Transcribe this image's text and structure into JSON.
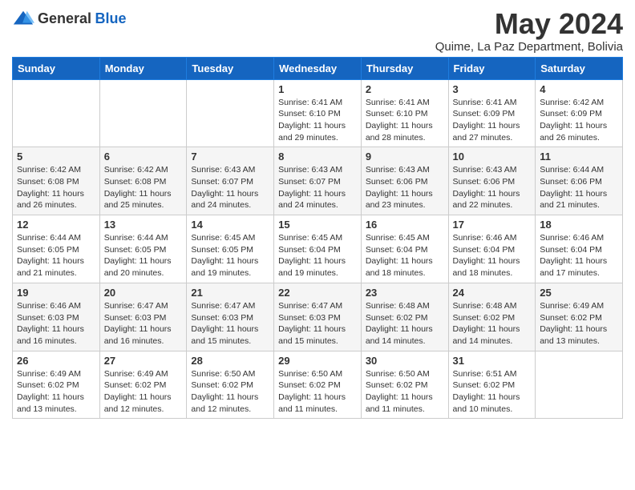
{
  "logo": {
    "general": "General",
    "blue": "Blue"
  },
  "header": {
    "month": "May 2024",
    "location": "Quime, La Paz Department, Bolivia"
  },
  "weekdays": [
    "Sunday",
    "Monday",
    "Tuesday",
    "Wednesday",
    "Thursday",
    "Friday",
    "Saturday"
  ],
  "weeks": [
    [
      {
        "day": "",
        "info": ""
      },
      {
        "day": "",
        "info": ""
      },
      {
        "day": "",
        "info": ""
      },
      {
        "day": "1",
        "info": "Sunrise: 6:41 AM\nSunset: 6:10 PM\nDaylight: 11 hours and 29 minutes."
      },
      {
        "day": "2",
        "info": "Sunrise: 6:41 AM\nSunset: 6:10 PM\nDaylight: 11 hours and 28 minutes."
      },
      {
        "day": "3",
        "info": "Sunrise: 6:41 AM\nSunset: 6:09 PM\nDaylight: 11 hours and 27 minutes."
      },
      {
        "day": "4",
        "info": "Sunrise: 6:42 AM\nSunset: 6:09 PM\nDaylight: 11 hours and 26 minutes."
      }
    ],
    [
      {
        "day": "5",
        "info": "Sunrise: 6:42 AM\nSunset: 6:08 PM\nDaylight: 11 hours and 26 minutes."
      },
      {
        "day": "6",
        "info": "Sunrise: 6:42 AM\nSunset: 6:08 PM\nDaylight: 11 hours and 25 minutes."
      },
      {
        "day": "7",
        "info": "Sunrise: 6:43 AM\nSunset: 6:07 PM\nDaylight: 11 hours and 24 minutes."
      },
      {
        "day": "8",
        "info": "Sunrise: 6:43 AM\nSunset: 6:07 PM\nDaylight: 11 hours and 24 minutes."
      },
      {
        "day": "9",
        "info": "Sunrise: 6:43 AM\nSunset: 6:06 PM\nDaylight: 11 hours and 23 minutes."
      },
      {
        "day": "10",
        "info": "Sunrise: 6:43 AM\nSunset: 6:06 PM\nDaylight: 11 hours and 22 minutes."
      },
      {
        "day": "11",
        "info": "Sunrise: 6:44 AM\nSunset: 6:06 PM\nDaylight: 11 hours and 21 minutes."
      }
    ],
    [
      {
        "day": "12",
        "info": "Sunrise: 6:44 AM\nSunset: 6:05 PM\nDaylight: 11 hours and 21 minutes."
      },
      {
        "day": "13",
        "info": "Sunrise: 6:44 AM\nSunset: 6:05 PM\nDaylight: 11 hours and 20 minutes."
      },
      {
        "day": "14",
        "info": "Sunrise: 6:45 AM\nSunset: 6:05 PM\nDaylight: 11 hours and 19 minutes."
      },
      {
        "day": "15",
        "info": "Sunrise: 6:45 AM\nSunset: 6:04 PM\nDaylight: 11 hours and 19 minutes."
      },
      {
        "day": "16",
        "info": "Sunrise: 6:45 AM\nSunset: 6:04 PM\nDaylight: 11 hours and 18 minutes."
      },
      {
        "day": "17",
        "info": "Sunrise: 6:46 AM\nSunset: 6:04 PM\nDaylight: 11 hours and 18 minutes."
      },
      {
        "day": "18",
        "info": "Sunrise: 6:46 AM\nSunset: 6:04 PM\nDaylight: 11 hours and 17 minutes."
      }
    ],
    [
      {
        "day": "19",
        "info": "Sunrise: 6:46 AM\nSunset: 6:03 PM\nDaylight: 11 hours and 16 minutes."
      },
      {
        "day": "20",
        "info": "Sunrise: 6:47 AM\nSunset: 6:03 PM\nDaylight: 11 hours and 16 minutes."
      },
      {
        "day": "21",
        "info": "Sunrise: 6:47 AM\nSunset: 6:03 PM\nDaylight: 11 hours and 15 minutes."
      },
      {
        "day": "22",
        "info": "Sunrise: 6:47 AM\nSunset: 6:03 PM\nDaylight: 11 hours and 15 minutes."
      },
      {
        "day": "23",
        "info": "Sunrise: 6:48 AM\nSunset: 6:02 PM\nDaylight: 11 hours and 14 minutes."
      },
      {
        "day": "24",
        "info": "Sunrise: 6:48 AM\nSunset: 6:02 PM\nDaylight: 11 hours and 14 minutes."
      },
      {
        "day": "25",
        "info": "Sunrise: 6:49 AM\nSunset: 6:02 PM\nDaylight: 11 hours and 13 minutes."
      }
    ],
    [
      {
        "day": "26",
        "info": "Sunrise: 6:49 AM\nSunset: 6:02 PM\nDaylight: 11 hours and 13 minutes."
      },
      {
        "day": "27",
        "info": "Sunrise: 6:49 AM\nSunset: 6:02 PM\nDaylight: 11 hours and 12 minutes."
      },
      {
        "day": "28",
        "info": "Sunrise: 6:50 AM\nSunset: 6:02 PM\nDaylight: 11 hours and 12 minutes."
      },
      {
        "day": "29",
        "info": "Sunrise: 6:50 AM\nSunset: 6:02 PM\nDaylight: 11 hours and 11 minutes."
      },
      {
        "day": "30",
        "info": "Sunrise: 6:50 AM\nSunset: 6:02 PM\nDaylight: 11 hours and 11 minutes."
      },
      {
        "day": "31",
        "info": "Sunrise: 6:51 AM\nSunset: 6:02 PM\nDaylight: 11 hours and 10 minutes."
      },
      {
        "day": "",
        "info": ""
      }
    ]
  ]
}
